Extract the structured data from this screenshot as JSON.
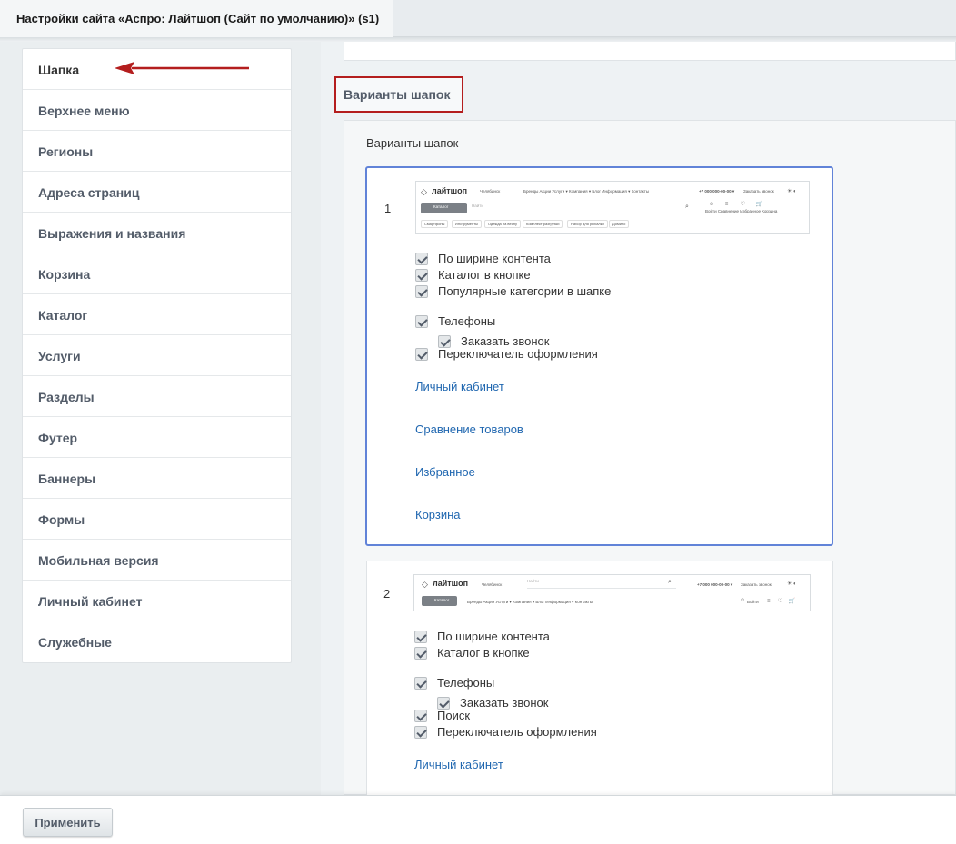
{
  "tab": {
    "title": "Настройки сайта «Аспро: Лайтшоп (Сайт по умолчанию)» (s1)"
  },
  "sidebar": {
    "items": [
      "Шапка",
      "Верхнее меню",
      "Регионы",
      "Адреса страниц",
      "Выражения и названия",
      "Корзина",
      "Каталог",
      "Услуги",
      "Разделы",
      "Футер",
      "Баннеры",
      "Формы",
      "Мобильная версия",
      "Личный кабинет",
      "Служебные"
    ],
    "active": "Шапка"
  },
  "section": {
    "title": "Варианты шапок",
    "label": "Варианты шапок"
  },
  "variants": [
    {
      "number": "1",
      "preview": {
        "logo": "лайтшоп",
        "city": "Челябинск",
        "nav": "Бренды   Акции   Услуги ▾   Компания ▾   Блог   Информация ▾   Контакты",
        "phone": "+7 000 000-00-00 ▾",
        "callback": "Заказать звонок",
        "catalog": "Каталог",
        "search_placeholder": "Найти",
        "icons_text": "Войти    Сравнение    Избранное    Корзина",
        "chips": [
          "Смартфоны",
          "Инструменты",
          "Одежда на весну",
          "Комплект разгрузки",
          "Набор для рыбалки",
          "Домино"
        ]
      },
      "options": [
        "По ширине контента",
        "Каталог в кнопке",
        "Популярные категории в шапке"
      ],
      "options2": [
        "Телефоны"
      ],
      "sub_option": "Заказать звонок",
      "options3": [
        "Переключатель оформления"
      ],
      "links": [
        "Личный кабинет",
        "Сравнение товаров",
        "Избранное",
        "Корзина"
      ]
    },
    {
      "number": "2",
      "preview": {
        "logo": "лайтшоп",
        "city": "Челябинск",
        "search_placeholder": "Найти",
        "phone": "+7 000 000-00-00 ▾",
        "callback": "Заказать звонок",
        "catalog": "Каталог",
        "nav": "Бренды   Акции   Услуги ▾   Компания ▾   Блог   Информация ▾   Контакты",
        "login": "Войти"
      },
      "options": [
        "По ширине контента",
        "Каталог в кнопке"
      ],
      "options2": [
        "Телефоны"
      ],
      "sub_option": "Заказать звонок",
      "options3": [
        "Поиск",
        "Переключатель оформления"
      ],
      "links": [
        "Личный кабинет"
      ]
    }
  ],
  "footer": {
    "apply_label": "Применить"
  },
  "colors": {
    "accent_border": "#6183d8",
    "highlight_red": "#b41e1e",
    "link": "#2067b0"
  }
}
